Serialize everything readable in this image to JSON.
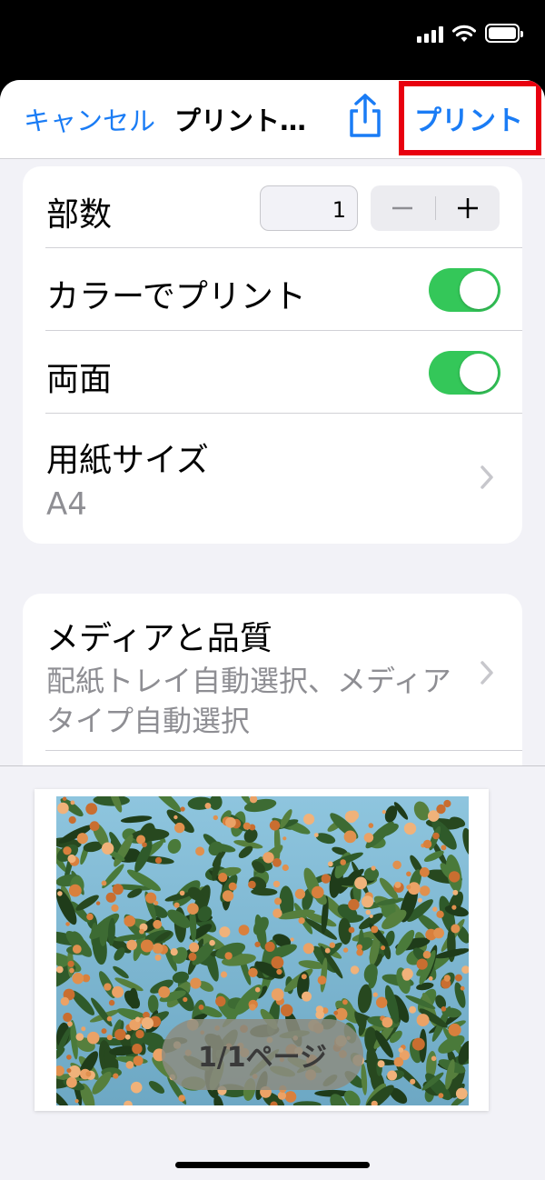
{
  "nav": {
    "cancel_label": "キャンセル",
    "title": "プリント…",
    "share_icon": "share-icon",
    "print_label": "プリント",
    "accent_color": "#1a7cf5",
    "highlight_color": "#e8000f"
  },
  "options": {
    "copies": {
      "label": "部数",
      "value": "1",
      "minus": "−",
      "plus": "+"
    },
    "color_print": {
      "label": "カラーでプリント",
      "on": true
    },
    "duplex": {
      "label": "両面",
      "on": true
    },
    "paper_size": {
      "label": "用紙サイズ",
      "value": "A4"
    },
    "media_quality": {
      "label": "メディアと品質",
      "value_line1": "配紙トレイ自動選択、メディア",
      "value_line2": "タイプ自動選択"
    }
  },
  "preview": {
    "page_indicator": "1/1ページ"
  },
  "colors": {
    "toggle_on": "#34c759",
    "secondary_text": "#8e8e93"
  }
}
